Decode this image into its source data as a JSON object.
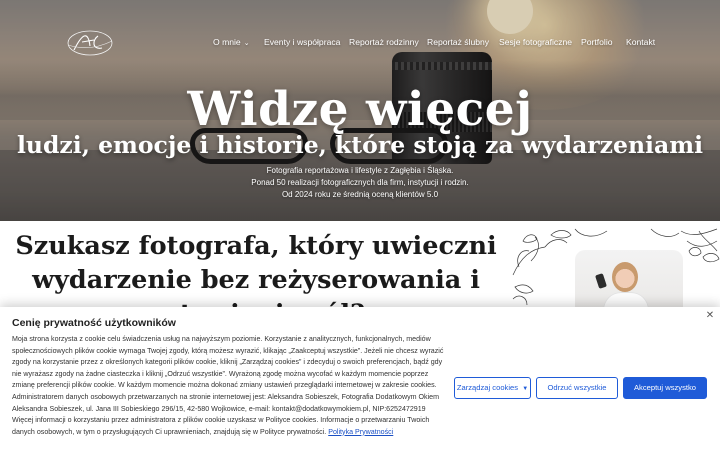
{
  "nav": {
    "items": [
      {
        "label": "O mnie",
        "has_dropdown": true
      },
      {
        "label": "Eventy i współpraca"
      },
      {
        "label": "Reportaż rodzinny"
      },
      {
        "label": "Reportaż ślubny"
      },
      {
        "label": "Sesje fotograficzne"
      },
      {
        "label": "Portfolio"
      },
      {
        "label": "Kontakt"
      }
    ],
    "dropdown_icon": "chevron-down-icon",
    "logo_icon": "signature-logo"
  },
  "hero": {
    "title": "Widzę więcej",
    "subtitle": "ludzi, emocje i historie, które stoją za wydarzeniami",
    "lines": [
      "Fotografia reportażowa i lifestyle z Zagłębia i Śląska.",
      "Ponad 50 realizacji fotograficznych dla firm, instytucji i rodzin.",
      "Od 2024 roku ze średnią oceną klientów 5.0"
    ]
  },
  "section": {
    "heading_lines": [
      "Szukasz fotografa, który uwieczni",
      "wydarzenie bez reżyserowania i",
      "ustawiania ról?"
    ]
  },
  "cookie": {
    "title": "Cenię prywatność użytkowników",
    "text_1": "Moja strona korzysta z cookie celu świadczenia usług na najwyższym poziomie. Korzystanie z analitycznych, funkcjonalnych, mediów społecznościowych plików cookie wymaga Twojej zgody, którą możesz wyrazić, klikając „Zaakceptuj wszystkie”. Jeżeli nie chcesz wyrazić zgody na korzystanie przez z  określonych kategorii plików cookie, kliknij „Zarządzaj cookies” i zdecyduj o swoich preferencjach, bądź gdy nie wyrażasz zgody na żadne ciasteczka i kliknij „Odrzuć wszystkie”. Wyrażoną zgodę można wycofać w każdym momencie poprzez zmianę preferencji plików cookie. W każdym momencie można  dokonać zmiany ustawień przeglądarki internetowej w zakresie cookies. Administratorem danych osobowych przetwarzanych na stronie internetowej jest: Aleksandra Sobieszek, Fotografia Dodatkowym Okiem Aleksandra Sobieszek, ul. Jana III Sobieskiego 296/15, 42-580 Wojkowice, e-mail: kontakt@dodatkowymokiem.pl, NIP:6252472919",
    "text_2": "Więcej informacji o korzystaniu przez administratora z plików cookie uzyskasz w Polityce cookies. Informacje o przetwarzaniu Twoich danych osobowych, w tym o przysługujących Ci uprawnieniach, znajdują się w Polityce prywatności. ",
    "privacy_link": "Polityka Prywatności",
    "close_icon": "close-icon",
    "buttons": {
      "manage": "Zarządzaj cookies",
      "reject": "Odrzuć wszystkie",
      "accept": "Akceptuj wszystko"
    }
  },
  "colors": {
    "accent": "#1f5bd8",
    "heading": "#1b1b1b"
  }
}
